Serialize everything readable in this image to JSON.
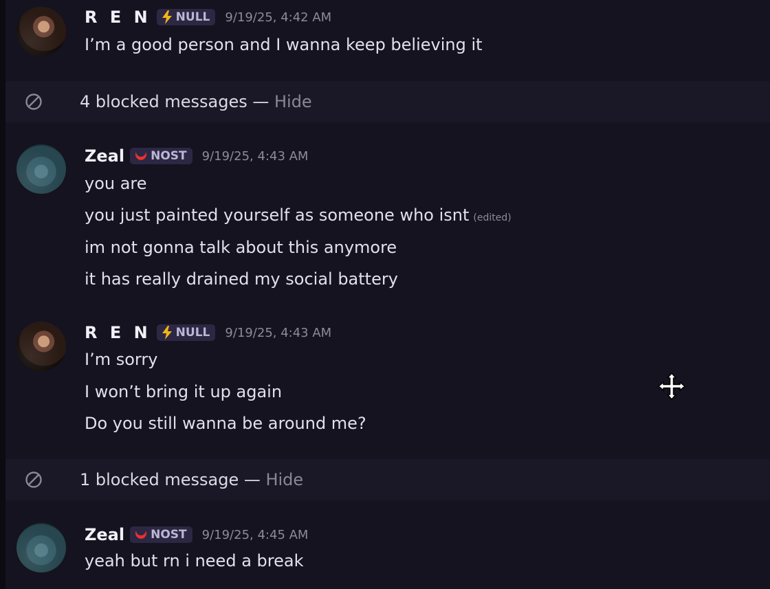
{
  "messages": [
    {
      "author": "R E N",
      "tag": "NULL",
      "timestamp": "9/19/25, 4:42 AM",
      "lines": [
        "I’m a good person and I wanna keep believing it"
      ]
    },
    {
      "author": "Zeal",
      "tag": "NOST",
      "timestamp": "9/19/25, 4:43 AM",
      "lines": [
        "you are",
        "you just painted yourself as someone who isnt",
        "im not gonna talk about this anymore",
        "it has really drained my social battery"
      ],
      "edited_label": "(edited)"
    },
    {
      "author": "R E N",
      "tag": "NULL",
      "timestamp": "9/19/25, 4:43 AM",
      "lines": [
        "I’m sorry",
        "I won’t bring it up again",
        "Do you still wanna be around me?"
      ]
    },
    {
      "author": "Zeal",
      "tag": "NOST",
      "timestamp": "9/19/25, 4:45 AM",
      "lines": [
        "yeah but rn i need a break"
      ]
    }
  ],
  "blocked": [
    {
      "text": "4 blocked messages — ",
      "action": "Hide"
    },
    {
      "text": "1 blocked message — ",
      "action": "Hide"
    }
  ],
  "icons": {
    "null_tag": "lightning-bolt-icon",
    "nost_tag": "crescent-icon",
    "blocked": "blocked-circle-icon",
    "cursor": "move-cursor-icon"
  },
  "colors": {
    "background": "#15131f",
    "blocked_row": "#1a1826",
    "tag_bg": "#2c2743",
    "bolt": "#f2b417",
    "crescent": "#e8322e"
  }
}
